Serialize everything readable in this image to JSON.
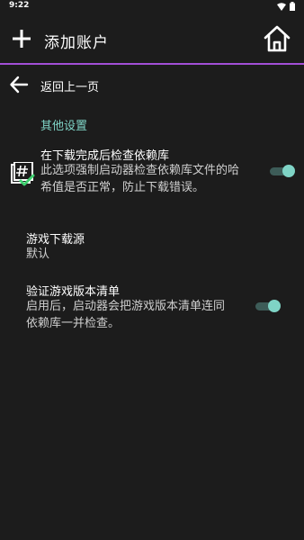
{
  "status_bar": {
    "time": "9:22"
  },
  "app_bar": {
    "title": "添加账户"
  },
  "back": {
    "label": "返回上一页"
  },
  "section": {
    "header": "其他设置"
  },
  "prefs": [
    {
      "title": "在下载完成后检查依赖库",
      "summary_line1": "此选项强制启动器检查依赖库文件的哈",
      "summary_line2": "希值是否正常，防止下载错误。",
      "enabled": true
    },
    {
      "title": "游戏下载源",
      "summary": "默认"
    },
    {
      "title": "验证游戏版本清单",
      "summary_line1": "启用后，启动器会把游戏版本清单连同",
      "summary_line2": "依赖库一并检查。",
      "enabled": true
    }
  ],
  "colors": {
    "accent": "#7fd4c6",
    "divider": "#a24fd6",
    "background": "#1c1c1c"
  },
  "icons": [
    "plus-icon",
    "home-icon",
    "back-arrow-icon",
    "hash-check-icon",
    "wifi-icon",
    "battery-icon"
  ]
}
